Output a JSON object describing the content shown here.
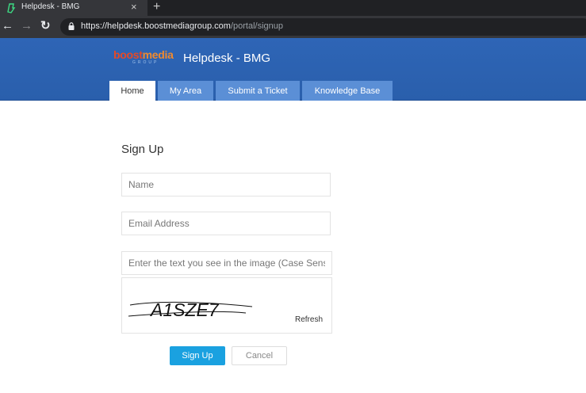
{
  "browser": {
    "tab_title": "Helpdesk - BMG",
    "tab_close": "×",
    "new_tab": "+",
    "url_host": "https://helpdesk.boostmediagroup.com",
    "url_path": "/portal/signup"
  },
  "header": {
    "logo_prefix": "boost",
    "logo_suffix": "media",
    "logo_sub": "GROUP",
    "title": "Helpdesk - BMG",
    "colors": {
      "bar": "#2e65b6",
      "tab": "#5b8fd6"
    }
  },
  "nav": {
    "tabs": [
      {
        "label": "Home",
        "active": true
      },
      {
        "label": "My Area",
        "active": false
      },
      {
        "label": "Submit a Ticket",
        "active": false
      },
      {
        "label": "Knowledge Base",
        "active": false
      }
    ]
  },
  "form": {
    "title": "Sign Up",
    "name_placeholder": "Name",
    "email_placeholder": "Email Address",
    "captcha_placeholder": "Enter the text you see in the image (Case Sensitive)",
    "captcha_text": "A1SZE7",
    "refresh_label": "Refresh",
    "submit_label": "Sign Up",
    "cancel_label": "Cancel",
    "accent": "#1aa1e0"
  }
}
